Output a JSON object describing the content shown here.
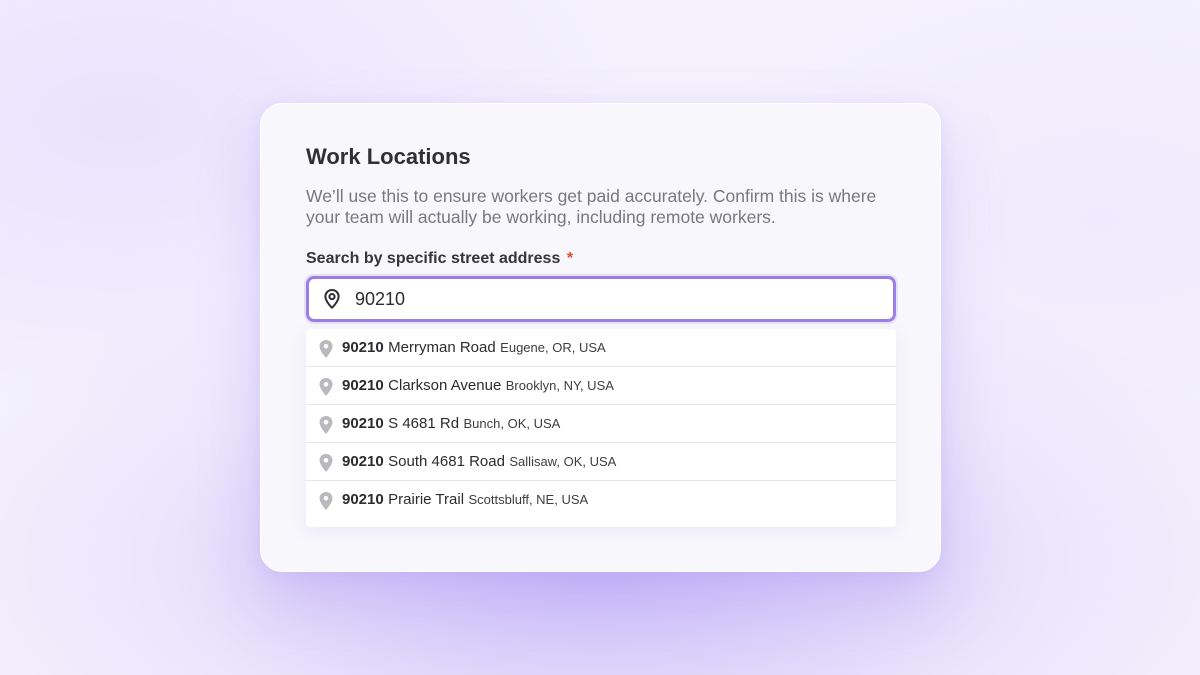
{
  "card": {
    "title": "Work Locations",
    "description": "We’ll use this to ensure workers get paid accurately. Confirm this is where your team will actually be working, including remote workers."
  },
  "search": {
    "label": "Search by specific street address",
    "required_marker": "*",
    "value": "90210",
    "icon": "location-pin-icon"
  },
  "suggestions": [
    {
      "zip": "90210",
      "street": "Merryman Road",
      "location": "Eugene, OR, USA"
    },
    {
      "zip": "90210",
      "street": "Clarkson Avenue",
      "location": "Brooklyn, NY, USA"
    },
    {
      "zip": "90210",
      "street": "S 4681 Rd",
      "location": "Bunch, OK, USA"
    },
    {
      "zip": "90210",
      "street": "South 4681 Road",
      "location": "Sallisaw, OK, USA"
    },
    {
      "zip": "90210",
      "street": "Prairie Trail",
      "location": "Scottsbluff, NE, USA"
    }
  ],
  "colors": {
    "accent": "#9b7ee8",
    "required": "#e0482d",
    "background": "#ece6fc"
  }
}
